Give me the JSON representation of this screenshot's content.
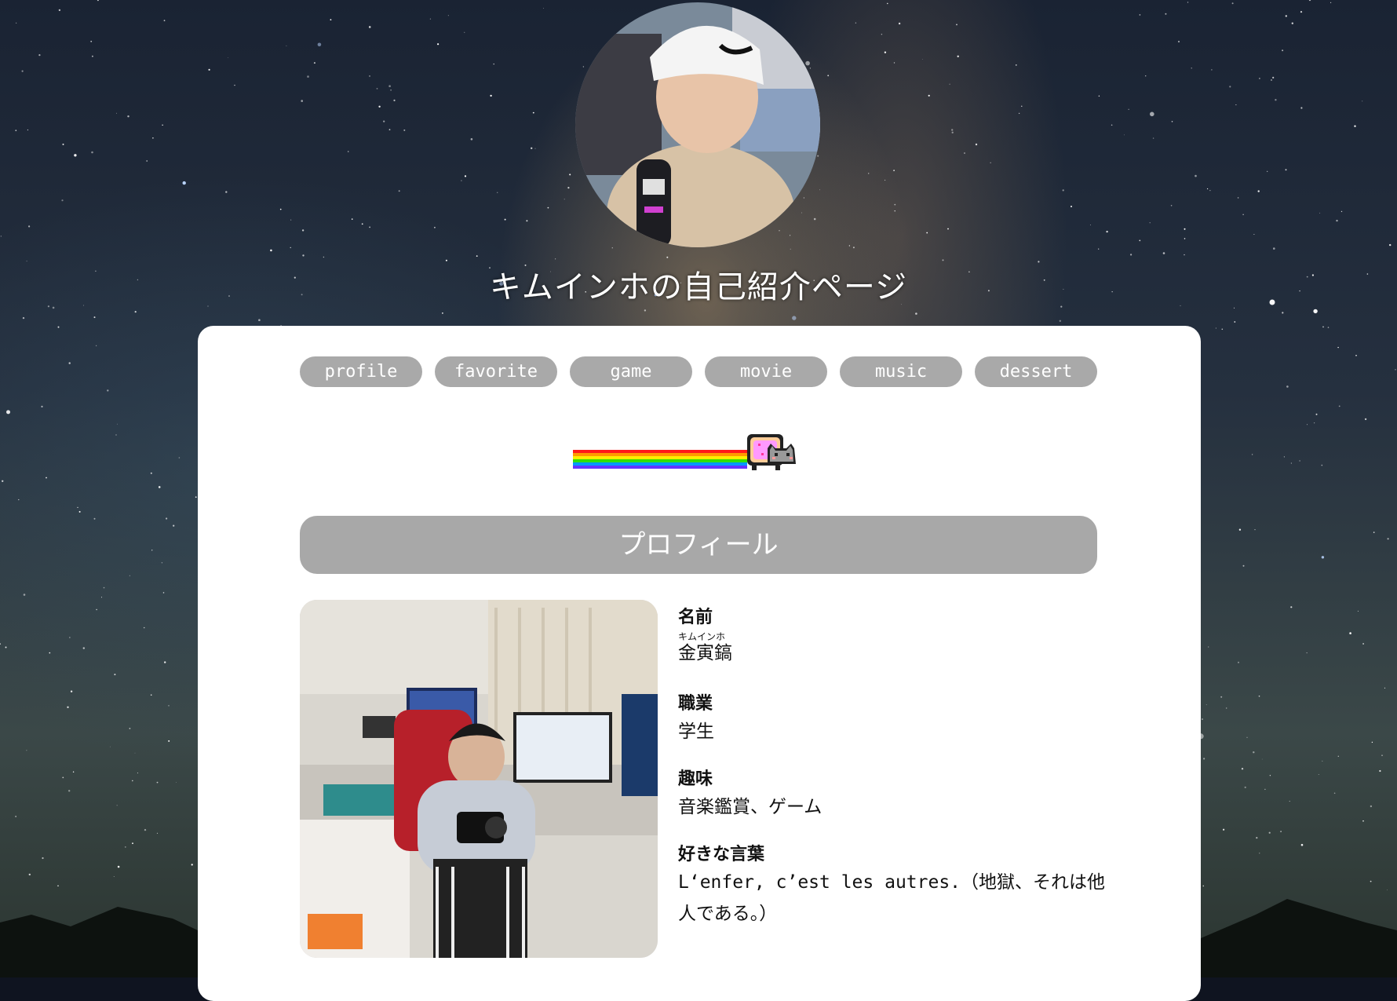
{
  "page": {
    "title": "キムインホの自己紹介ページ"
  },
  "nav": {
    "items": [
      "profile",
      "favorite",
      "game",
      "movie",
      "music",
      "dessert"
    ]
  },
  "section": {
    "header": "プロフィール"
  },
  "profile": {
    "fields": [
      {
        "label": "名前",
        "ruby": "キムインホ",
        "value": "金寅鎬"
      },
      {
        "label": "職業",
        "value": "学生"
      },
      {
        "label": "趣味",
        "value": "音楽鑑賞、ゲーム"
      },
      {
        "label": "好きな言葉",
        "value": "L‘enfer, c’est les autres.（地獄、それは他人である。）"
      }
    ]
  },
  "colors": {
    "nav_button": "#a9a9a9",
    "section_header": "#a8a8a8",
    "card": "#ffffff",
    "text": "#111111"
  },
  "icons": [
    "avatar-photo",
    "nyan-cat-rainbow",
    "profile-photo"
  ]
}
